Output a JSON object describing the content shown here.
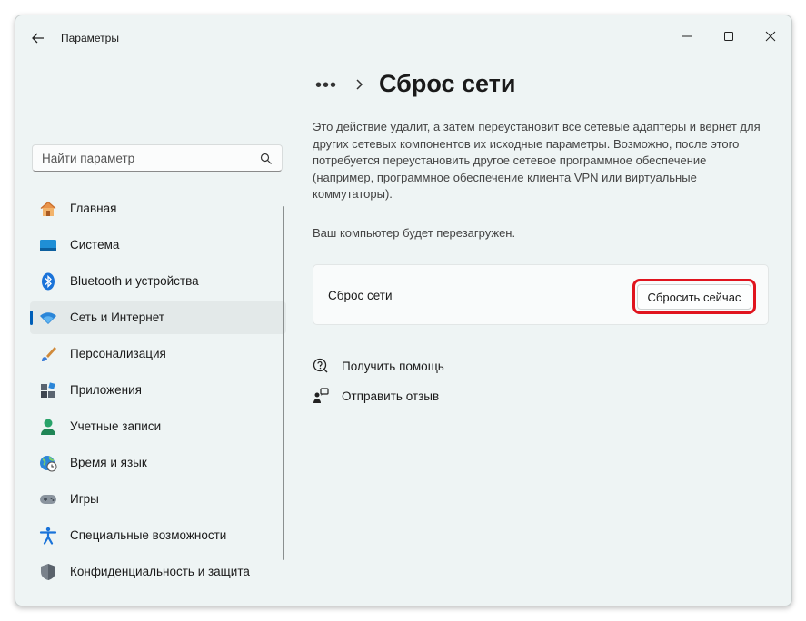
{
  "window": {
    "title": "Параметры",
    "controls": [
      "minimize-icon",
      "maximize-icon",
      "close-icon"
    ]
  },
  "search": {
    "placeholder": "Найти параметр",
    "icon": "search-icon"
  },
  "sidebar": {
    "items": [
      {
        "label": "Главная",
        "icon": "home-icon"
      },
      {
        "label": "Система",
        "icon": "monitor-icon"
      },
      {
        "label": "Bluetooth и устройства",
        "icon": "bluetooth-icon"
      },
      {
        "label": "Сеть и Интернет",
        "icon": "wifi-icon",
        "active": true
      },
      {
        "label": "Персонализация",
        "icon": "brush-icon"
      },
      {
        "label": "Приложения",
        "icon": "apps-icon"
      },
      {
        "label": "Учетные записи",
        "icon": "account-icon"
      },
      {
        "label": "Время и язык",
        "icon": "globe-clock-icon"
      },
      {
        "label": "Игры",
        "icon": "gamepad-icon"
      },
      {
        "label": "Специальные возможности",
        "icon": "accessibility-icon"
      },
      {
        "label": "Конфиденциальность и защита",
        "icon": "shield-icon"
      }
    ]
  },
  "main": {
    "breadcrumb_more": "•••",
    "title": "Сброс сети",
    "description": "Это действие удалит, а затем переустановит все сетевые адаптеры и вернет для других сетевых компонентов их исходные параметры. Возможно, после этого потребуется переустановить другое сетевое программное обеспечение (например, программное обеспечение клиента VPN или виртуальные коммутаторы).",
    "restart_note": "Ваш компьютер будет перезагружен.",
    "card": {
      "label": "Сброс сети",
      "button": "Сбросить сейчас"
    },
    "links": {
      "help": "Получить помощь",
      "feedback": "Отправить отзыв"
    }
  },
  "colors": {
    "accent": "#005fb8",
    "highlight": "#e0141e",
    "window_bg": "#eef4f4"
  }
}
